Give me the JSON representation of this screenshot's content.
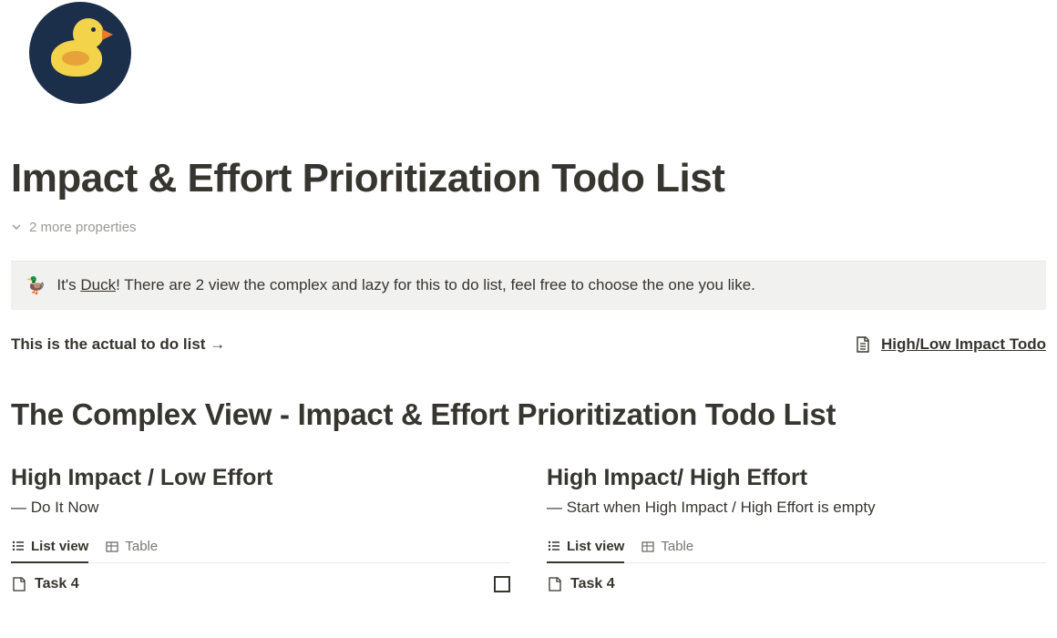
{
  "page": {
    "title": "Impact & Effort Prioritization Todo List",
    "more_properties": "2 more properties"
  },
  "callout": {
    "text_before": "It's ",
    "link_text": "Duck",
    "text_after": "! There are 2 view the complex and lazy for this to do list, feel free to choose the one you like."
  },
  "link_row": {
    "label": "This is the actual to do list →",
    "page_link": "High/Low Impact Todo"
  },
  "section": {
    "title": "The Complex View - Impact & Effort Prioritization Todo List"
  },
  "views": {
    "list": "List view",
    "table": "Table"
  },
  "quadrants": [
    {
      "title": "High Impact / Low Effort",
      "subtitle": "— Do It Now",
      "task": "Task 4"
    },
    {
      "title": "High Impact/ High Effort",
      "subtitle": "— Start when High Impact / High Effort is empty",
      "task": "Task 4"
    }
  ]
}
